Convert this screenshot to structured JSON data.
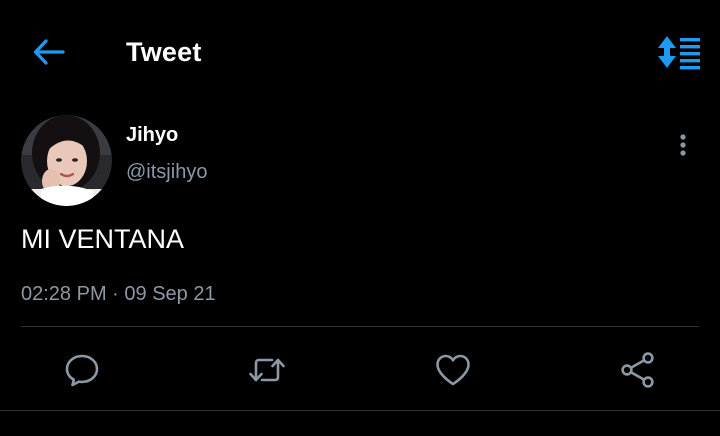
{
  "header": {
    "title": "Tweet",
    "back_icon": "arrow-left-icon",
    "sort_icon": "sort-list-icon",
    "accent_color": "#1d9bf0"
  },
  "tweet": {
    "author": {
      "display_name": "Jihyo",
      "handle": "@itsjihyo",
      "avatar": "avatar-photo"
    },
    "text": "MI VENTANA",
    "time": "02:28 PM",
    "separator": "·",
    "date": "09 Sep 21"
  },
  "actions": {
    "reply_icon": "reply-icon",
    "retweet_icon": "retweet-icon",
    "like_icon": "heart-icon",
    "share_icon": "share-icon"
  },
  "colors": {
    "background": "#000000",
    "text": "#ffffff",
    "secondary_text": "#8b98a5",
    "divider": "#2f3336"
  }
}
